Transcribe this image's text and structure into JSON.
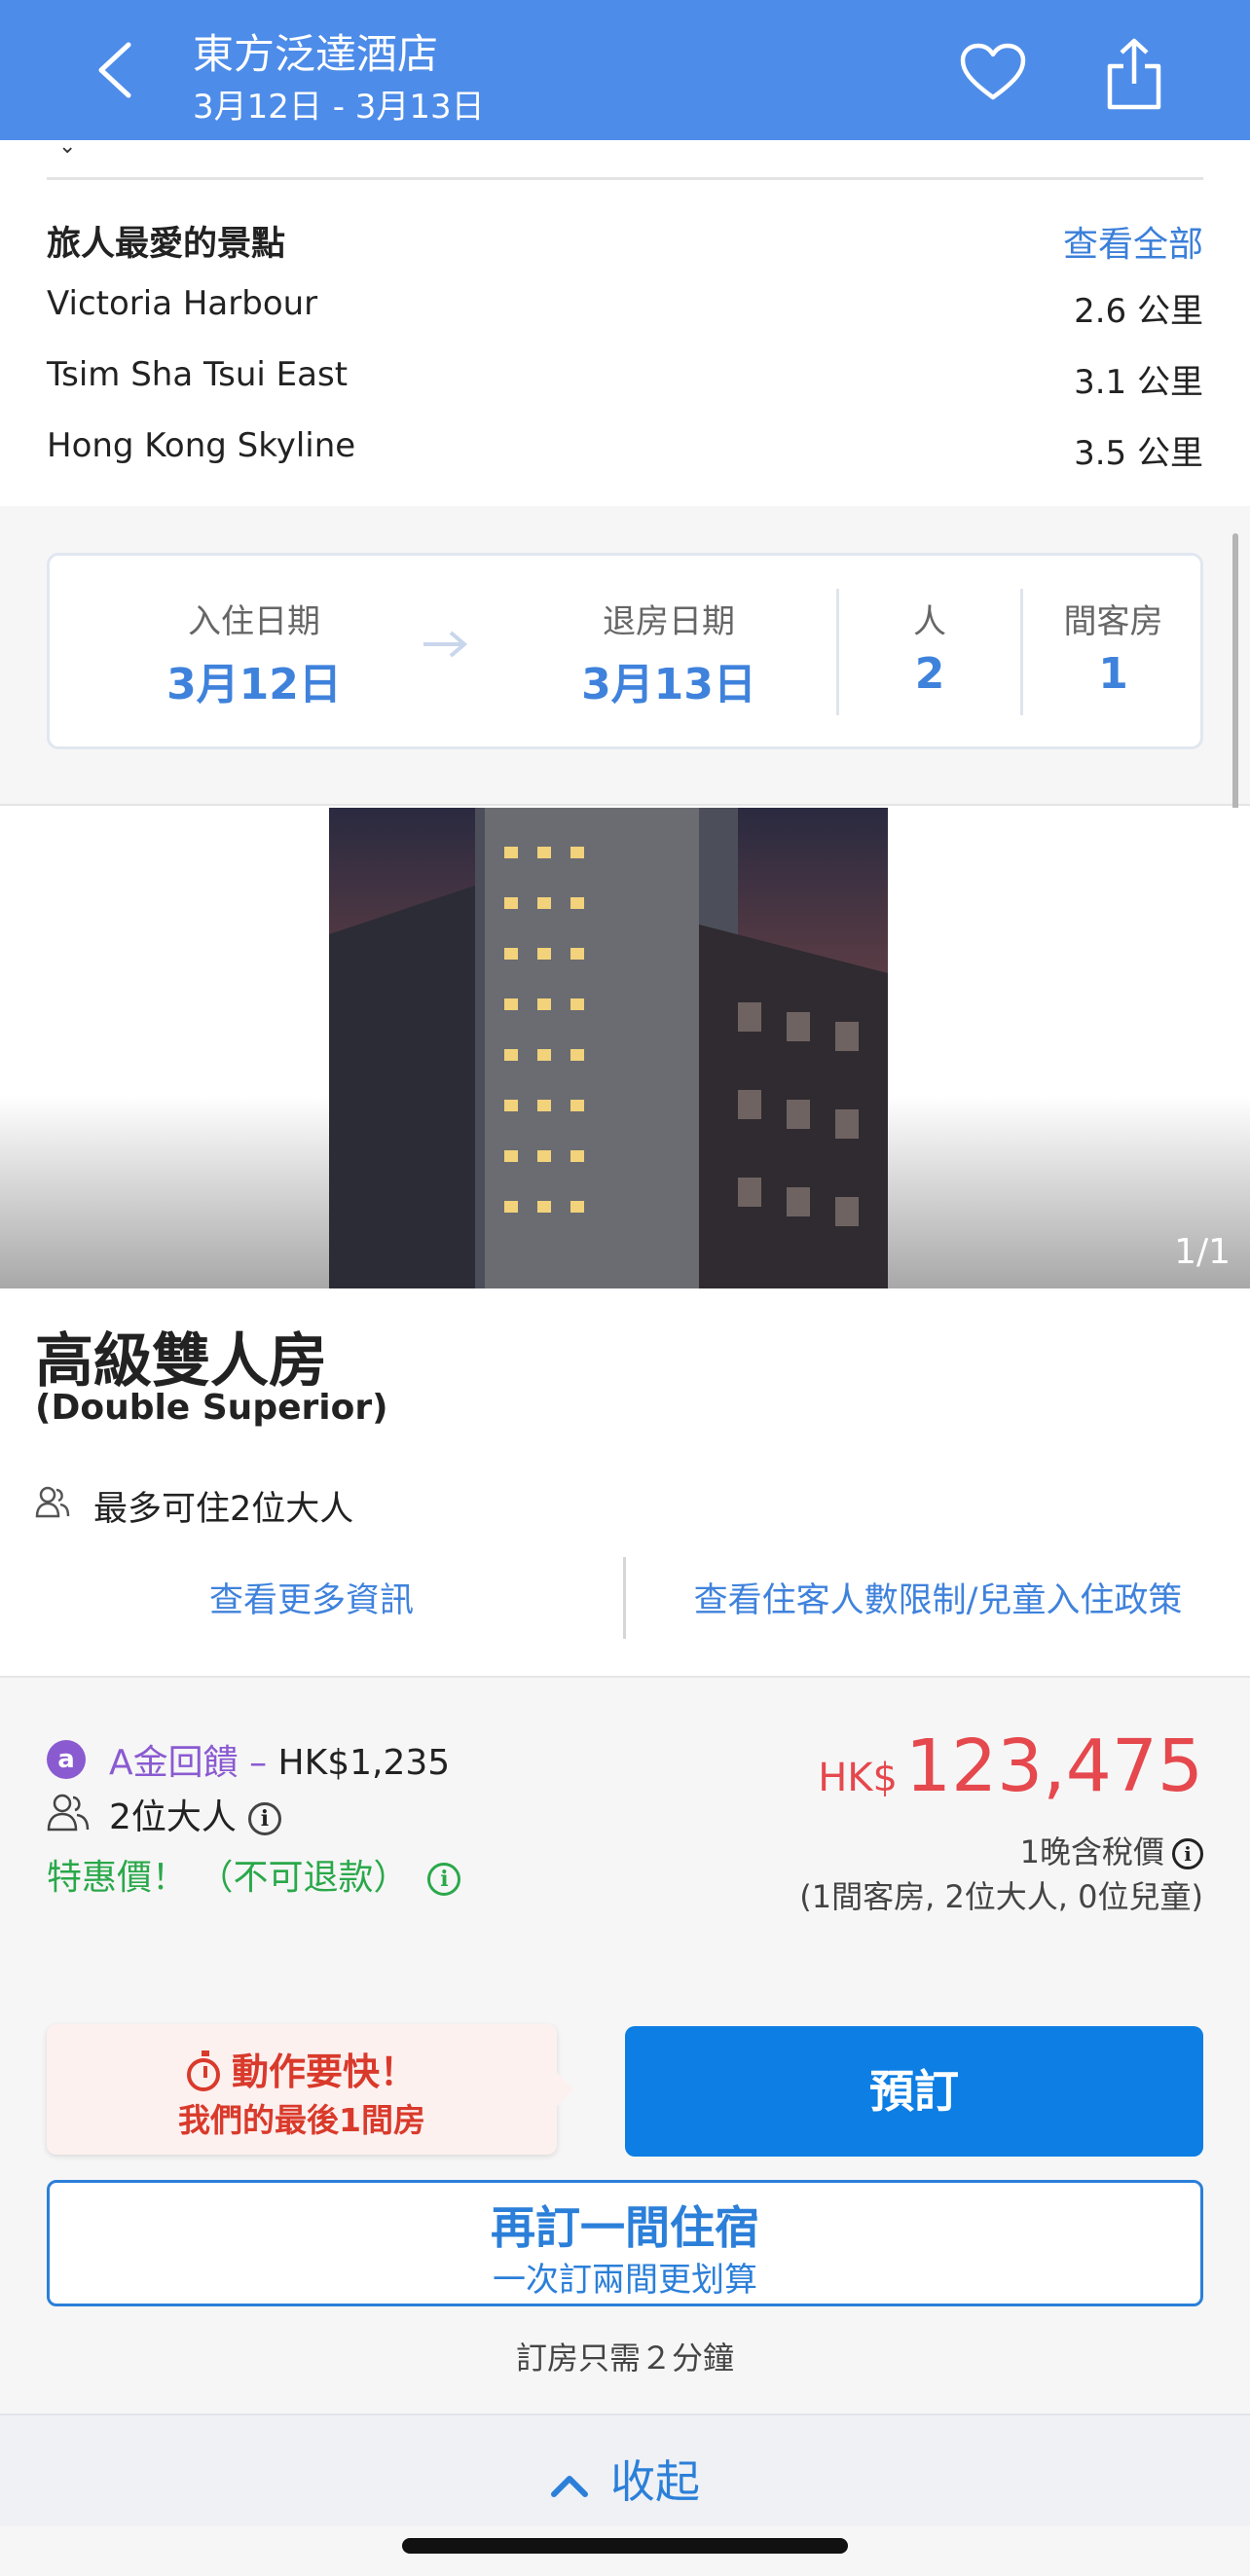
{
  "header": {
    "title": "東方泛達酒店",
    "subtitle": "3月12日 - 3月13日"
  },
  "attractions": {
    "title": "旅人最愛的景點",
    "view_all": "查看全部",
    "items": [
      {
        "name": "Victoria Harbour",
        "distance": "2.6 公里"
      },
      {
        "name": "Tsim Sha Tsui East",
        "distance": "3.1 公里"
      },
      {
        "name": "Hong Kong Skyline",
        "distance": "3.5 公里"
      }
    ]
  },
  "dates": {
    "checkin_label": "入住日期",
    "checkin_value": "3月12日",
    "checkout_label": "退房日期",
    "checkout_value": "3月13日",
    "guests_label": "人",
    "guests_value": "2",
    "rooms_label": "間客房",
    "rooms_value": "1"
  },
  "photo": {
    "counter": "1/1"
  },
  "room": {
    "name": "高級雙人房",
    "name_en": "(Double Superior)",
    "occupancy": "最多可住2位大人",
    "more_info": "查看更多資訊",
    "policy": "查看住客人數限制/兒童入住政策"
  },
  "offer": {
    "coin_symbol": "a",
    "cashback_label": "A金回饋 –",
    "cashback_amount": "HK$1,235",
    "guests": "2位大人",
    "deal": "特惠價！ （不可退款）",
    "currency": "HK$",
    "price": "123,475",
    "per_night": "1晚含稅價",
    "detail": "(1間客房, 2位大人, 0位兒童)",
    "urgent_title": "動作要快！",
    "urgent_sub": "我們的最後1間房",
    "book": "預訂",
    "another_title": "再訂一間住宿",
    "another_sub": "一次訂兩間更划算",
    "two_min": "訂房只需２分鐘",
    "collapse": "收起"
  },
  "colors": {
    "header_bg": "#4d8ce9",
    "link_blue": "#3f82dc",
    "price_red": "#e5484d",
    "deal_green": "#2aa84a",
    "cash_purple": "#8a5ad1",
    "book_blue": "#0d7ee3"
  },
  "icons": [
    "back-arrow-icon",
    "heart-icon",
    "share-icon",
    "arrow-right-icon",
    "people-icon",
    "info-icon",
    "timer-icon",
    "chevron-up-icon",
    "chevron-down-icon"
  ]
}
